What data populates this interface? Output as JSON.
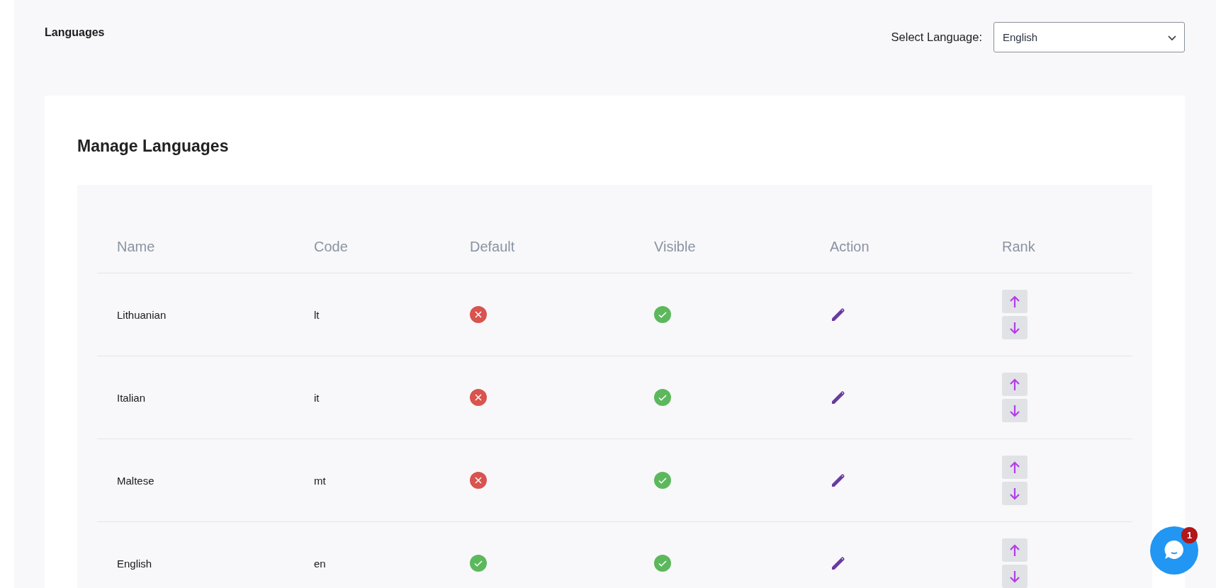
{
  "page_title": "Languages",
  "language_select": {
    "label": "Select Language:",
    "value": "English"
  },
  "card": {
    "title": "Manage Languages"
  },
  "table": {
    "columns": [
      "Name",
      "Code",
      "Default",
      "Visible",
      "Action",
      "Rank"
    ],
    "rows": [
      {
        "name": "Lithuanian",
        "code": "lt",
        "default": false,
        "visible": true
      },
      {
        "name": "Italian",
        "code": "it",
        "default": false,
        "visible": true
      },
      {
        "name": "Maltese",
        "code": "mt",
        "default": false,
        "visible": true
      },
      {
        "name": "English",
        "code": "en",
        "default": true,
        "visible": true
      }
    ]
  },
  "chat": {
    "badge": "1"
  }
}
